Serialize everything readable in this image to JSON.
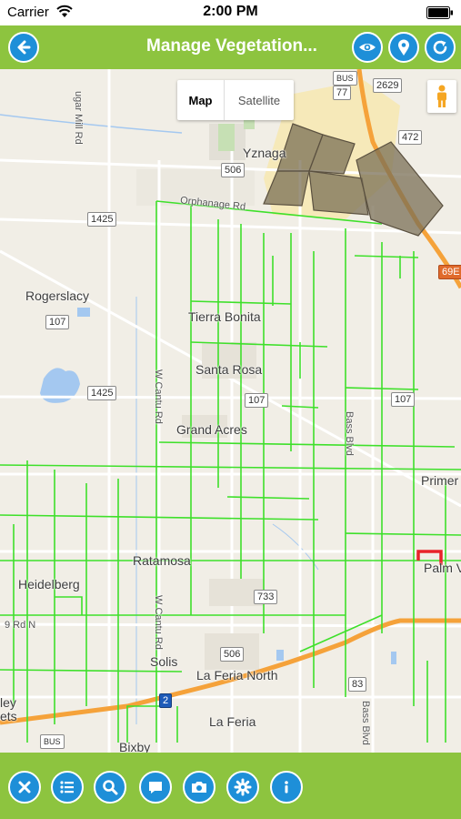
{
  "status": {
    "carrier": "Carrier",
    "time": "2:00 PM"
  },
  "nav": {
    "title": "Manage Vegetation...",
    "back_icon": "back-arrow-icon",
    "right_icons": [
      "eye-icon",
      "location-pin-icon",
      "refresh-icon"
    ]
  },
  "map": {
    "toggle": {
      "map_label": "Map",
      "satellite_label": "Satellite",
      "selected": "Map"
    },
    "places": {
      "yznaga": "Yznaga",
      "rogerslacy": "Rogerslacy",
      "tierra_bonita": "Tierra Bonita",
      "santa_rosa": "Santa Rosa",
      "grand_acres": "Grand Acres",
      "primera": "Primer",
      "ratamosa": "Ratamosa",
      "heidelberg": "Heidelberg",
      "solis": "Solis",
      "la_feria_north": "La Feria North",
      "la_feria": "La Feria",
      "bixby": "Bixby",
      "palm_valley": "Palm V",
      "ley": "ley",
      "ets": "ets"
    },
    "roads": {
      "orphanage_rd": "Orphanage Rd",
      "sugar_mill_rd": "ugar Mill Rd",
      "w_cantu_rd_1": "W Cantu Rd",
      "w_cantu_rd_2": "W Cantu Rd",
      "bass_blvd_1": "Bass Blvd",
      "bass_blvd_2": "Bass Blvd",
      "rd_9": "9 Rd N"
    },
    "shields": {
      "s2629": "2629",
      "s472": "472",
      "s506a": "506",
      "s1425a": "1425",
      "s69e": "69E",
      "s107a": "107",
      "s1425b": "1425",
      "s107b": "107",
      "s107c": "107",
      "s733": "733",
      "s506b": "506",
      "s2": "2",
      "s83": "83",
      "s77": "77",
      "bus1": "BUS",
      "bus2": "BUS"
    },
    "colors": {
      "vegetation_lines": "#3ee02a",
      "highway": "#f5a23a",
      "polygon_fill": "#7a6f55",
      "selected_marker": "#e8242a"
    }
  },
  "toolbar": {
    "icons": [
      "close-icon",
      "list-icon",
      "search-icon",
      "chat-icon",
      "camera-icon",
      "settings-icon",
      "info-icon"
    ]
  },
  "colors": {
    "bar_green": "#8dc43f",
    "button_blue": "#1e8fd8"
  }
}
